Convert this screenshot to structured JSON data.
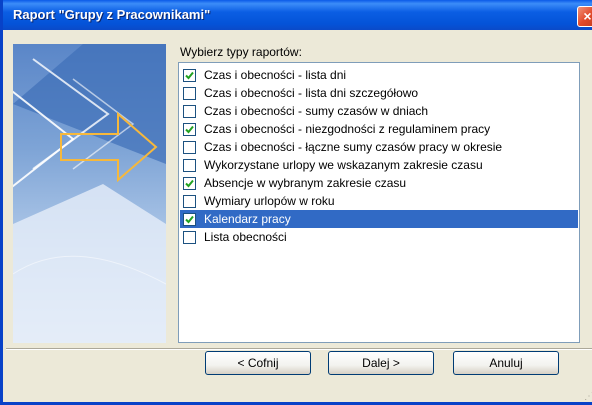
{
  "window": {
    "title": "Raport \"Grupy z Pracownikami\"",
    "close_label": "×"
  },
  "report_types": {
    "label": "Wybierz typy raportów:",
    "items": [
      {
        "label": "Czas i obecności - lista dni",
        "checked": true,
        "selected": false
      },
      {
        "label": "Czas i obecności - lista dni szczegółowo",
        "checked": false,
        "selected": false
      },
      {
        "label": "Czas i obecności - sumy czasów w dniach",
        "checked": false,
        "selected": false
      },
      {
        "label": "Czas i obecności - niezgodności z regulaminem pracy",
        "checked": true,
        "selected": false
      },
      {
        "label": "Czas i obecności - łączne sumy czasów pracy w okresie",
        "checked": false,
        "selected": false
      },
      {
        "label": "Wykorzystane urlopy we wskazanym zakresie czasu",
        "checked": false,
        "selected": false
      },
      {
        "label": "Absencje w wybranym zakresie czasu",
        "checked": true,
        "selected": false
      },
      {
        "label": "Wymiary urlopów w roku",
        "checked": false,
        "selected": false
      },
      {
        "label": "Kalendarz pracy",
        "checked": true,
        "selected": true
      },
      {
        "label": "Lista obecności",
        "checked": false,
        "selected": false
      }
    ]
  },
  "buttons": {
    "back": "< Cofnij",
    "next": "Dalej >",
    "cancel": "Anuluj"
  },
  "colors": {
    "title_bar": "#0453d8",
    "selection": "#316ac5",
    "check_mark": "#21a121"
  }
}
